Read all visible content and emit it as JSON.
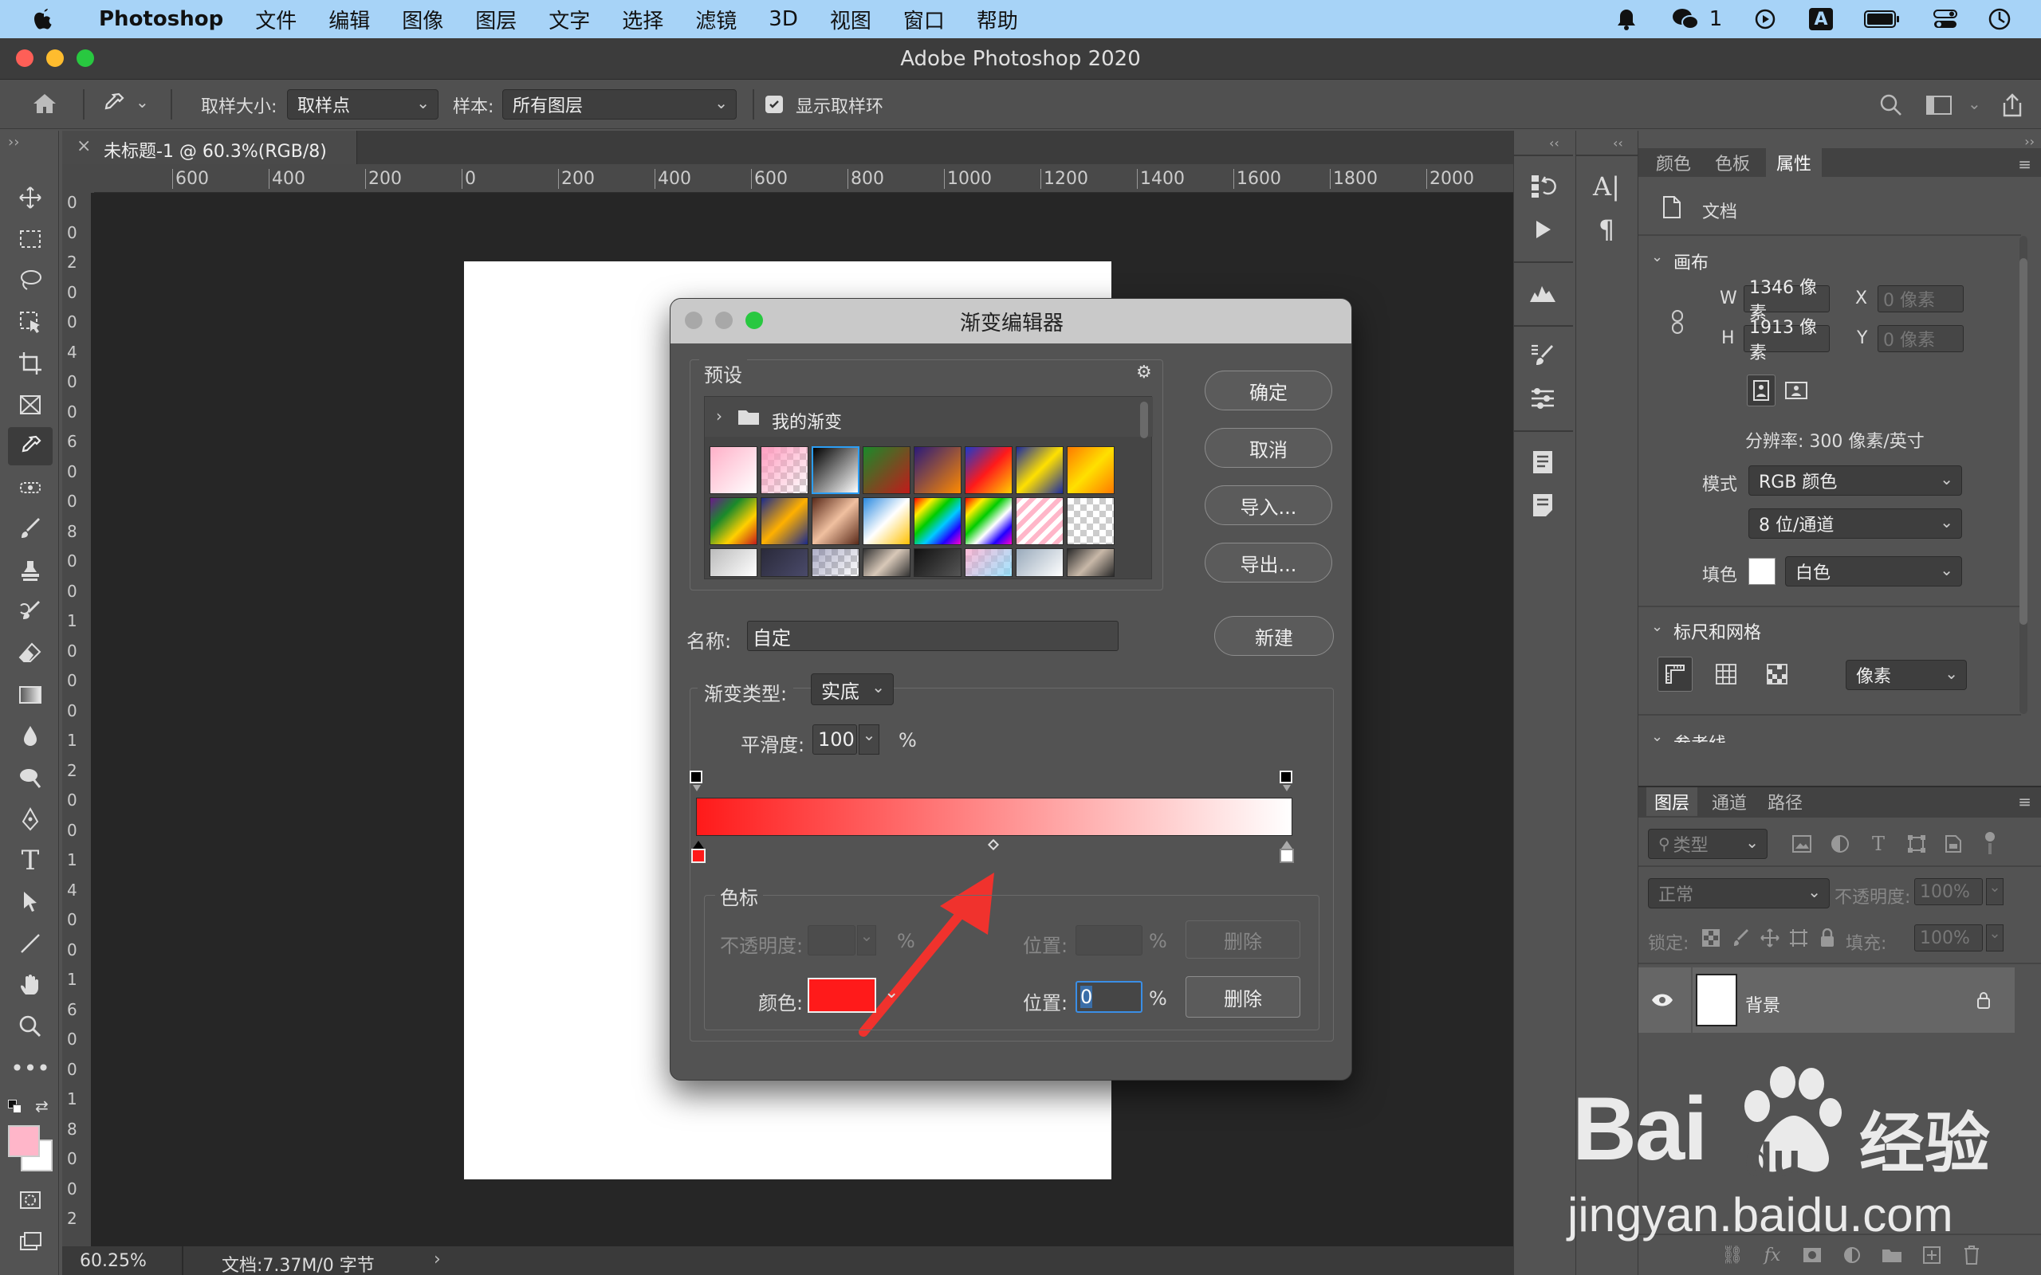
{
  "menubar": {
    "app": "Photoshop",
    "items": [
      "文件",
      "编辑",
      "图像",
      "图层",
      "文字",
      "选择",
      "滤镜",
      "3D",
      "视图",
      "窗口",
      "帮助"
    ],
    "wechat_count": "1"
  },
  "window": {
    "title": "Adobe Photoshop 2020"
  },
  "options": {
    "sample_size_label": "取样大小:",
    "sample_size_value": "取样点",
    "sample_label": "样本:",
    "sample_value": "所有图层",
    "show_ring_label": "显示取样环",
    "show_ring_checked": true
  },
  "document": {
    "tab_title": "未标题-1 @ 60.3%(RGB/8)",
    "zoom": "60.25%",
    "doc_info": "文档:7.37M/0 字节",
    "ruler_h": [
      "600",
      "400",
      "200",
      "0",
      "200",
      "400",
      "600",
      "800",
      "1000",
      "1200",
      "1400",
      "1600",
      "1800",
      "2000"
    ],
    "ruler_v": [
      "0",
      "0",
      "2",
      "0",
      "0",
      "4",
      "0",
      "0",
      "6",
      "0",
      "0",
      "8",
      "0",
      "0",
      "1",
      "0",
      "0",
      "0",
      "1",
      "2",
      "0",
      "0",
      "1",
      "4",
      "0",
      "0",
      "1",
      "6",
      "0",
      "0",
      "1",
      "8",
      "0",
      "0",
      "2"
    ]
  },
  "properties_panel": {
    "tabs": [
      "颜色",
      "色板",
      "属性"
    ],
    "active_tab": "属性",
    "doc_label": "文档",
    "canvas_section": "画布",
    "w_label": "W",
    "w_value": "1346 像素",
    "h_label": "H",
    "h_value": "1913 像素",
    "x_label": "X",
    "x_placeholder": "0 像素",
    "y_label": "Y",
    "y_placeholder": "0 像素",
    "resolution": "分辨率: 300 像素/英寸",
    "mode_label": "模式",
    "mode_value": "RGB 颜色",
    "depth_value": "8 位/通道",
    "fill_label": "填色",
    "fill_value": "白色",
    "rulers_section": "标尺和网格",
    "unit_value": "像素",
    "guides_section": "参考线"
  },
  "layers_panel": {
    "tabs": [
      "图层",
      "通道",
      "路径"
    ],
    "filter_placeholder": "类型",
    "blend_mode": "正常",
    "opacity_label": "不透明度:",
    "opacity_value": "100%",
    "lock_label": "锁定:",
    "fill_label": "填充:",
    "fill_value": "100%",
    "layer_name": "背景"
  },
  "gradient_editor": {
    "title": "渐变编辑器",
    "presets_label": "预设",
    "folder_label": "我的渐变",
    "ok": "确定",
    "cancel": "取消",
    "import": "导入...",
    "export": "导出...",
    "name_label": "名称:",
    "name_value": "自定",
    "new": "新建",
    "type_label": "渐变类型:",
    "type_value": "实底",
    "smooth_label": "平滑度:",
    "smooth_value": "100",
    "percent": "%",
    "stops_label": "色标",
    "opacity_label": "不透明度:",
    "position_label": "位置:",
    "delete_label": "删除",
    "color_label": "颜色:",
    "color_value": "#ff1a1a",
    "position_value": "0",
    "gradient_start": "#ff1a1a",
    "gradient_end": "#ffffff"
  },
  "watermark": {
    "brand": "Bai",
    "brand2": "du",
    "cn": "经验",
    "url": "jingyan.baidu.com"
  }
}
